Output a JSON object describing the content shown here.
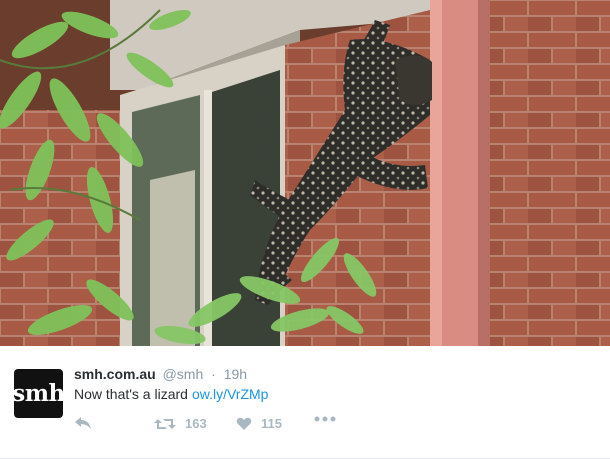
{
  "photo": {
    "subject": "lizard on brick wall",
    "colors": {
      "brick": "#a85a44",
      "mortar": "#b6897a",
      "downpipe": "#d98c82",
      "leaves": "#7fc25a",
      "lizard": "#2e2c28"
    }
  },
  "tweet": {
    "avatar_text": "smh",
    "display_name": "smh.com.au",
    "handle": "@smh",
    "separator": "·",
    "timestamp": "19h",
    "text": "Now that's a lizard",
    "link": "ow.ly/VrZMp",
    "actions": {
      "reply_icon": "reply-icon",
      "retweet_icon": "retweet-icon",
      "retweet_count": "163",
      "like_icon": "heart-icon",
      "like_count": "115",
      "more_icon": "more-icon"
    },
    "colors": {
      "name": "#292f33",
      "meta": "#8899a6",
      "link": "#1b95e0",
      "icon": "#aab8c2"
    }
  }
}
